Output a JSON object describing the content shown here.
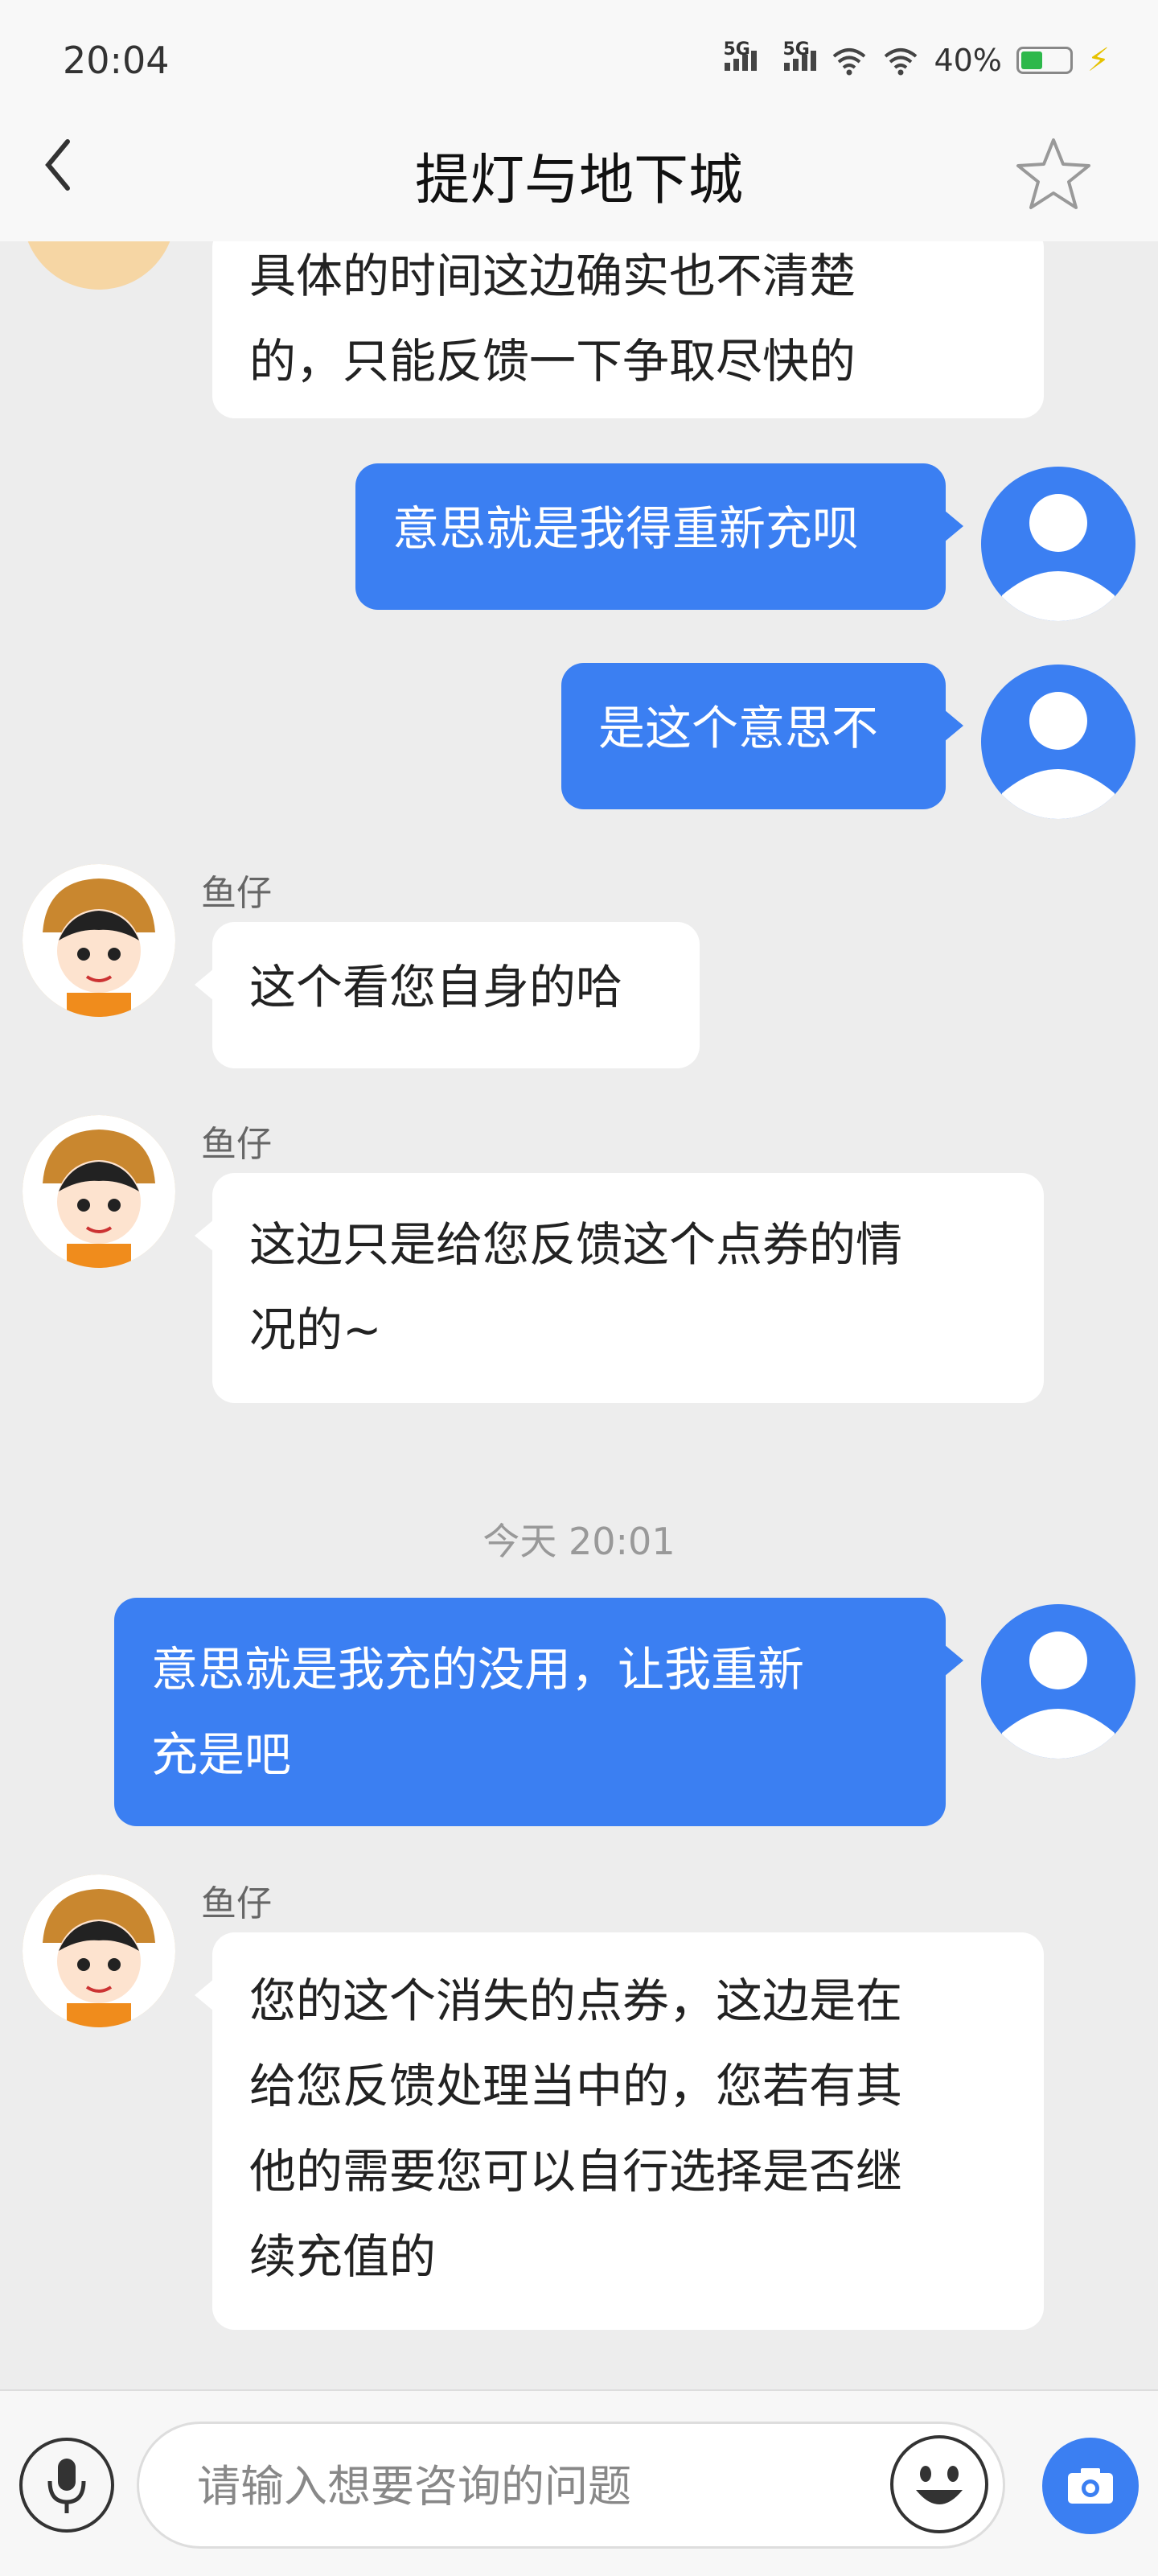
{
  "status_bar": {
    "time": "20:04",
    "signal1_label": "5G",
    "signal2_label": "5G",
    "battery_percent": "40%",
    "battery_level": 0.4
  },
  "header": {
    "title": "提灯与地下城",
    "back_icon": "chevron-left-icon",
    "favorite_icon": "star-outline-icon"
  },
  "messages": [
    {
      "from": "cs",
      "lines": [
        "具体的时间这边确实也不清楚",
        "的，只能反馈一下争取尽快的"
      ]
    },
    {
      "from": "me",
      "text": "意思就是我得重新充呗"
    },
    {
      "from": "me",
      "text": "是这个意思不"
    },
    {
      "from": "cs",
      "sender": "鱼仔",
      "text": "这个看您自身的哈"
    },
    {
      "from": "cs",
      "sender": "鱼仔",
      "lines": [
        "这边只是给您反馈这个点券的情",
        "况的~"
      ]
    },
    {
      "timestamp": "今天 20:01"
    },
    {
      "from": "me",
      "lines": [
        "意思就是我充的没用，让我重新",
        "充是吧"
      ]
    },
    {
      "from": "cs",
      "sender": "鱼仔",
      "lines": [
        "您的这个消失的点券，这边是在",
        "给您反馈处理当中的，您若有其",
        "他的需要您可以自行选择是否继",
        "续充值的"
      ]
    }
  ],
  "input_bar": {
    "placeholder": "请输入想要咨询的问题",
    "value": "",
    "mic_icon": "microphone-icon",
    "emoji_icon": "smiley-face-icon",
    "camera_icon": "camera-icon"
  },
  "colors": {
    "accent_blue": "#3b7ff2",
    "chat_background": "#ededed",
    "bubble_white": "#ffffff"
  }
}
